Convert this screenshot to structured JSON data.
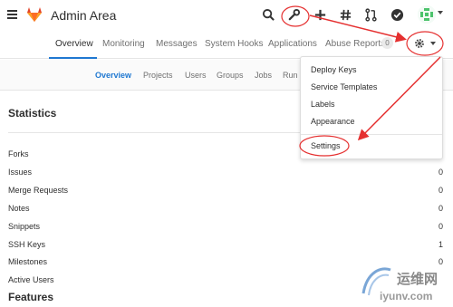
{
  "app": {
    "title": "Admin Area"
  },
  "top_icons": [
    "search-icon",
    "wrench-icon",
    "plus-icon",
    "hash-icon",
    "merge-request-icon",
    "todo-check-icon"
  ],
  "nav": {
    "tabs": [
      {
        "label": "Overview",
        "active": true
      },
      {
        "label": "Monitoring"
      },
      {
        "label": "Messages"
      },
      {
        "label": "System Hooks"
      },
      {
        "label": "Applications"
      },
      {
        "label": "Abuse Reports"
      }
    ],
    "abuse_badge": "0"
  },
  "subnav": {
    "items": [
      {
        "label": "Overview",
        "active": true
      },
      {
        "label": "Projects"
      },
      {
        "label": "Users"
      },
      {
        "label": "Groups"
      },
      {
        "label": "Jobs"
      },
      {
        "label": "Run"
      }
    ]
  },
  "statistics": {
    "title": "Statistics",
    "rows": [
      {
        "label": "Forks",
        "value": ""
      },
      {
        "label": "Issues",
        "value": "0"
      },
      {
        "label": "Merge Requests",
        "value": "0"
      },
      {
        "label": "Notes",
        "value": "0"
      },
      {
        "label": "Snippets",
        "value": "0"
      },
      {
        "label": "SSH Keys",
        "value": "1"
      },
      {
        "label": "Milestones",
        "value": "0"
      },
      {
        "label": "Active Users",
        "value": ""
      }
    ]
  },
  "features": {
    "title": "Features"
  },
  "dropdown": {
    "items": [
      "Deploy Keys",
      "Service Templates",
      "Labels",
      "Appearance"
    ],
    "settings": "Settings"
  },
  "watermark": {
    "text": "运维网",
    "url": "iyunv.com"
  },
  "colors": {
    "accent": "#1f78d1",
    "annotation": "#e53030"
  }
}
